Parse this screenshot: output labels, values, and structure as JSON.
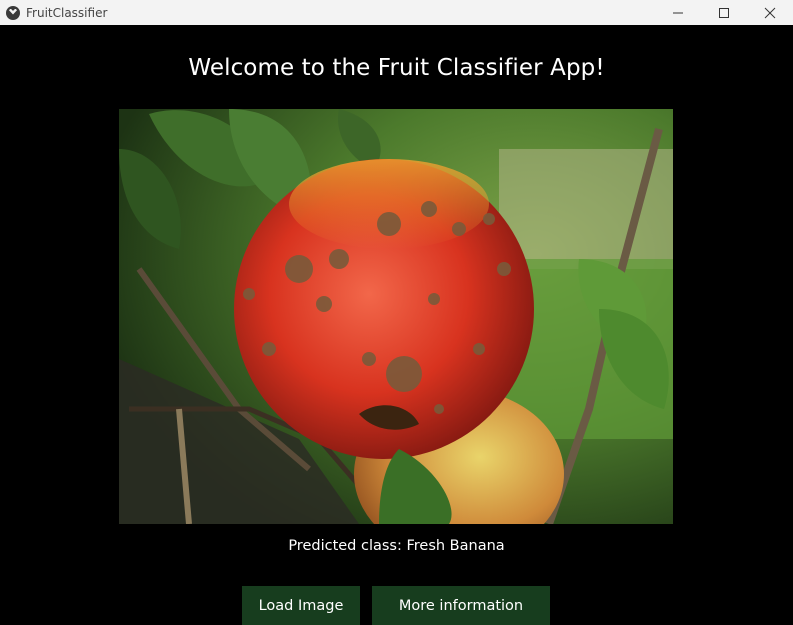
{
  "window": {
    "title": "FruitClassifier",
    "icon": "app-logo-icon",
    "controls": [
      "minimize-icon",
      "maximize-icon",
      "close-icon"
    ]
  },
  "main": {
    "heading": "Welcome to the Fruit Classifier App!",
    "image": {
      "description_icon": "fruit-photo",
      "subject": "apple"
    },
    "prediction_text": "Predicted class: Fresh Banana",
    "buttons": {
      "load_label": "Load Image",
      "info_label": "More information"
    }
  },
  "colors": {
    "background": "#000000",
    "button": "#173d1e",
    "titlebar": "#f3f3f3",
    "text": "#ffffff"
  }
}
